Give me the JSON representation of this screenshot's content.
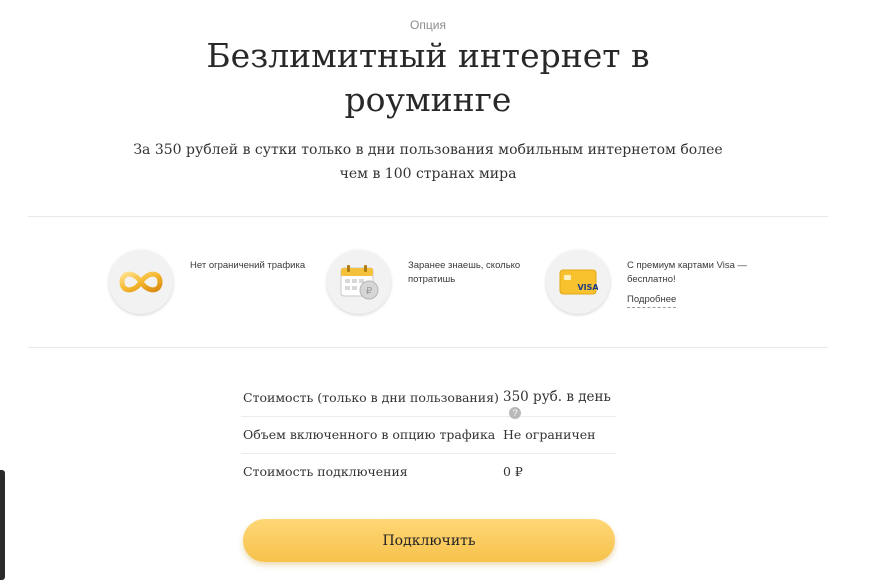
{
  "header": {
    "eyebrow": "Опция",
    "title_line1": "Безлимитный интернет в",
    "title_line2": "роуминге",
    "subtitle": "За 350 рублей в сутки только в дни пользования мобильным интернетом более чем в 100 странах мира"
  },
  "features": [
    {
      "icon": "infinity-ribbon-icon",
      "text": "Нет ограничений трафика"
    },
    {
      "icon": "calendar-coin-icon",
      "text": "Заранее знаешь, сколько потратишь"
    },
    {
      "icon": "visa-card-icon",
      "text": "С премиум картами Visa — бесплатно!",
      "link": "Подробнее"
    }
  ],
  "pricing": [
    {
      "label": "Стоимость (только в дни пользования)",
      "value": "350 руб. в день",
      "help": "?"
    },
    {
      "label": "Объем включенного в опцию трафика",
      "value": "Не ограничен"
    },
    {
      "label": "Стоимость подключения",
      "value": "0 ₽"
    }
  ],
  "cta": {
    "label": "Подключить"
  },
  "colors": {
    "accent": "#f6c24c",
    "accent_light": "#ffd777",
    "text": "#282828",
    "muted": "#8c8c8c"
  }
}
